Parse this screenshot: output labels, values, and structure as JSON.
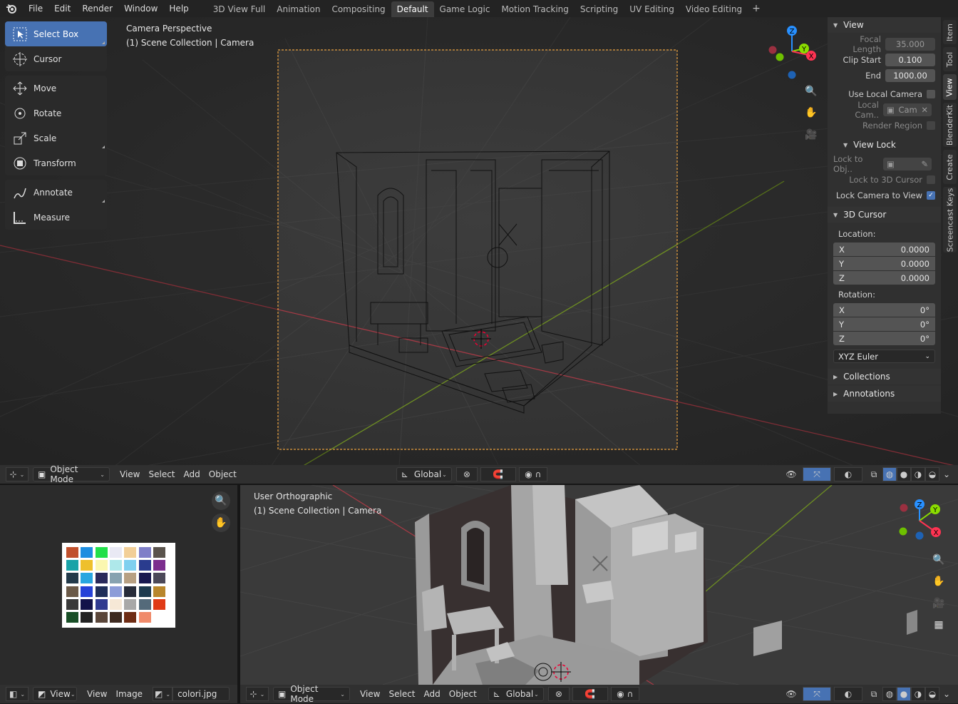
{
  "menu": [
    "File",
    "Edit",
    "Render",
    "Window",
    "Help"
  ],
  "workspaces": [
    "3D View Full",
    "Animation",
    "Compositing",
    "Default",
    "Game Logic",
    "Motion Tracking",
    "Scripting",
    "UV Editing",
    "Video Editing"
  ],
  "active_workspace": "Default",
  "tools": {
    "select_box": "Select Box",
    "cursor": "Cursor",
    "move": "Move",
    "rotate": "Rotate",
    "scale": "Scale",
    "transform": "Transform",
    "annotate": "Annotate",
    "measure": "Measure"
  },
  "viewport_main": {
    "line1": "Camera Perspective",
    "line2": "(1) Scene Collection | Camera"
  },
  "viewport_bottom": {
    "line1": "User Orthographic",
    "line2": "(1) Scene Collection | Camera"
  },
  "header_main": {
    "mode": "Object Mode",
    "view": "View",
    "select": "Select",
    "add": "Add",
    "object": "Object",
    "transform_orientation": "Global"
  },
  "header_bottom": {
    "mode": "Object Mode",
    "view": "View",
    "select": "Select",
    "add": "Add",
    "object": "Object",
    "transform_orientation": "Global"
  },
  "image_editor": {
    "view_dd": "View",
    "view": "View",
    "image": "Image",
    "filename": "colori.jpg"
  },
  "npanel": {
    "view_title": "View",
    "focal_length_label": "Focal Length",
    "focal_length": "35.000",
    "clip_start_label": "Clip Start",
    "clip_start": "0.100",
    "end_label": "End",
    "end": "1000.00",
    "use_local_camera": "Use Local Camera",
    "local_cam_label": "Local Cam..",
    "local_cam_value": "Cam",
    "render_region": "Render Region",
    "view_lock_title": "View Lock",
    "lock_to_obj": "Lock to Obj..",
    "lock_to_3d_cursor": "Lock to 3D Cursor",
    "lock_camera_to_view": "Lock Camera to View",
    "cursor_title": "3D Cursor",
    "location_label": "Location:",
    "loc_x": "0.0000",
    "loc_y": "0.0000",
    "loc_z": "0.0000",
    "rotation_label": "Rotation:",
    "rot_x": "0°",
    "rot_y": "0°",
    "rot_z": "0°",
    "rotation_mode": "XYZ Euler",
    "collections": "Collections",
    "annotations": "Annotations",
    "axis_x": "X",
    "axis_y": "Y",
    "axis_z": "Z"
  },
  "side_tabs": [
    "Item",
    "Tool",
    "View",
    "BlenderKit",
    "Create",
    "Screencast Keys"
  ],
  "active_side_tab": "View",
  "gizmo": {
    "x": "X",
    "y": "Y",
    "z": "Z"
  },
  "palette_colors": [
    "#c0502c",
    "#1e8ee0",
    "#22e04a",
    "#e9e9f4",
    "#f2cf98",
    "#7f7fc8",
    "#5a534c",
    "#1aa3a8",
    "#eec02c",
    "#fbf7b0",
    "#aee8ea",
    "#7fd0ef",
    "#2a3c8e",
    "#7c2e8e",
    "#233a4a",
    "#28a6e0",
    "#2a2a5a",
    "#87a2b0",
    "#b7a083",
    "#191950",
    "#4b4858",
    "#6b5a48",
    "#2642d8",
    "#1f2e58",
    "#8c9cd8",
    "#272c3a",
    "#1e3a4e",
    "#b8862c",
    "#3a3a3a",
    "#12124a",
    "#303a90",
    "#f6e8d6",
    "#a8a8a8",
    "#546a7a",
    "#e03a16",
    "#184e26",
    "#222222",
    "#5a463a",
    "#3e2a20",
    "#6e2c14",
    "#f08a6a"
  ],
  "colors": {
    "accent": "#4772b3",
    "camera_frame": "#e8a040",
    "x_axis": "#ff3352",
    "y_axis": "#8bdc00",
    "z_axis": "#2890ff"
  }
}
